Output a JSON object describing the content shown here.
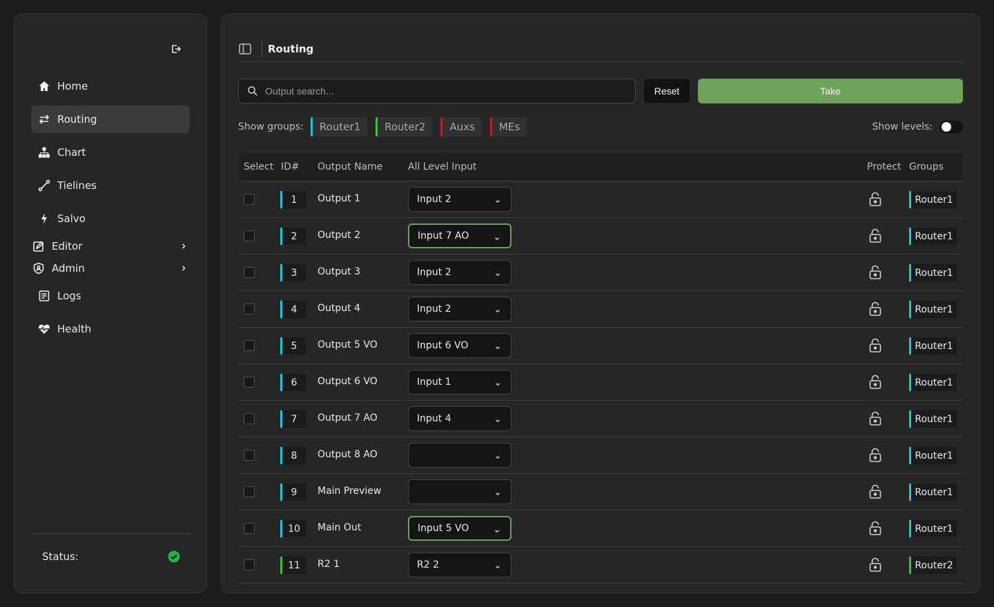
{
  "sidebar": {
    "nav": [
      {
        "label": "Home",
        "icon": "home-icon"
      },
      {
        "label": "Routing",
        "icon": "routing-arrows-icon",
        "active": true
      },
      {
        "label": "Chart",
        "icon": "chart-hierarchy-icon"
      },
      {
        "label": "Tielines",
        "icon": "tieline-icon"
      },
      {
        "label": "Salvo",
        "icon": "lightning-icon"
      },
      {
        "label": "Editor",
        "icon": "edit-icon",
        "expandable": true
      },
      {
        "label": "Admin",
        "icon": "shield-icon",
        "expandable": true
      },
      {
        "label": "Logs",
        "icon": "logs-icon"
      },
      {
        "label": "Health",
        "icon": "heart-pulse-icon"
      }
    ],
    "status_label": "Status:"
  },
  "header": {
    "breadcrumb": "Routing"
  },
  "toolbar": {
    "search_placeholder": "Output search...",
    "reset_label": "Reset",
    "take_label": "Take"
  },
  "groups": {
    "label": "Show groups:",
    "items": [
      {
        "name": "Router1",
        "color": "#27c3d4"
      },
      {
        "name": "Router2",
        "color": "#3fbf3f"
      },
      {
        "name": "Auxs",
        "color": "#b02626"
      },
      {
        "name": "MEs",
        "color": "#b02626"
      }
    ],
    "levels_label": "Show levels:"
  },
  "table": {
    "columns": [
      "Select",
      "ID#",
      "Output Name",
      "All Level Input",
      "Protect",
      "Groups"
    ],
    "rows": [
      {
        "id": "1",
        "name": "Output 1",
        "input": "Input 2",
        "changed": false,
        "group": "Router1",
        "color": "#27c3d4"
      },
      {
        "id": "2",
        "name": "Output 2",
        "input": "Input 7 AO",
        "changed": true,
        "group": "Router1",
        "color": "#27c3d4"
      },
      {
        "id": "3",
        "name": "Output 3",
        "input": "Input 2",
        "changed": false,
        "group": "Router1",
        "color": "#27c3d4"
      },
      {
        "id": "4",
        "name": "Output 4",
        "input": "Input 2",
        "changed": false,
        "group": "Router1",
        "color": "#27c3d4"
      },
      {
        "id": "5",
        "name": "Output 5 VO",
        "input": "Input 6 VO",
        "changed": false,
        "group": "Router1",
        "color": "#27c3d4"
      },
      {
        "id": "6",
        "name": "Output 6 VO",
        "input": "Input 1",
        "changed": false,
        "group": "Router1",
        "color": "#27c3d4"
      },
      {
        "id": "7",
        "name": "Output 7 AO",
        "input": "Input 4",
        "changed": false,
        "group": "Router1",
        "color": "#27c3d4"
      },
      {
        "id": "8",
        "name": "Output 8 AO",
        "input": "",
        "changed": false,
        "group": "Router1",
        "color": "#27c3d4"
      },
      {
        "id": "9",
        "name": "Main Preview",
        "input": "",
        "changed": false,
        "group": "Router1",
        "color": "#27c3d4"
      },
      {
        "id": "10",
        "name": "Main Out",
        "input": "Input 5 VO",
        "changed": true,
        "group": "Router1",
        "color": "#27c3d4"
      },
      {
        "id": "11",
        "name": "R2 1",
        "input": "R2 2",
        "changed": false,
        "group": "Router2",
        "color": "#3fbf3f"
      }
    ]
  }
}
